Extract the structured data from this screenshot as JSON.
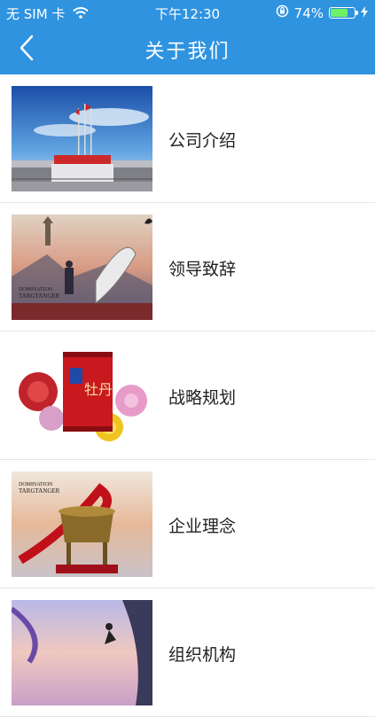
{
  "status_bar": {
    "carrier": "无 SIM 卡",
    "time": "下午12:30",
    "battery_percent": "74%",
    "battery_level": 0.74
  },
  "nav": {
    "title": "关于我们"
  },
  "items": [
    {
      "label": "公司介绍",
      "thumb_icon": "company-photo"
    },
    {
      "label": "领导致辞",
      "thumb_icon": "leader-speech-artwork"
    },
    {
      "label": "战略规划",
      "thumb_icon": "product-can-with-flowers"
    },
    {
      "label": "企业理念",
      "thumb_icon": "bronze-cauldron-artwork"
    },
    {
      "label": "组织机构",
      "thumb_icon": "climber-artwork"
    }
  ],
  "images": {
    "product_can_text": "牡丹",
    "domination_text": "DOMINATION",
    "targtanger_text": "TARGTANGER"
  },
  "colors": {
    "header": "#2f93e0",
    "battery": "#6ef067"
  }
}
